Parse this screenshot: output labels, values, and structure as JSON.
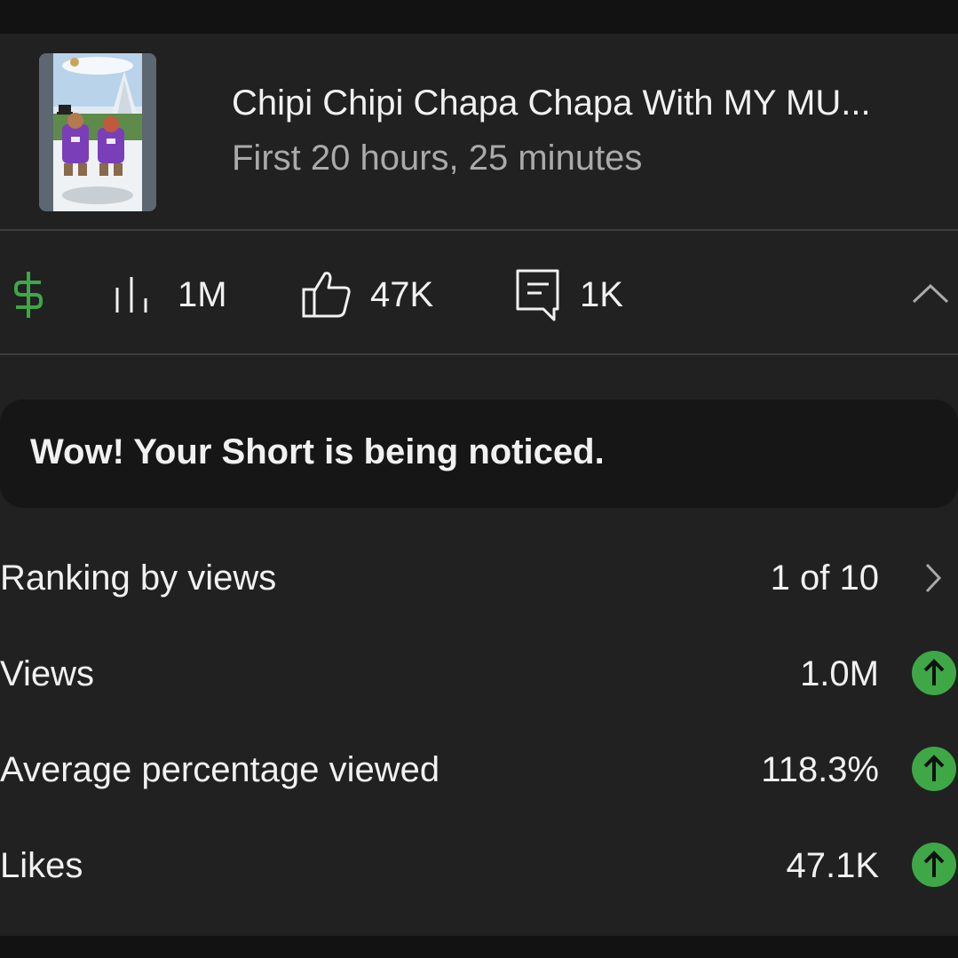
{
  "video": {
    "title": "Chipi Chipi Chapa Chapa With MY MU...",
    "subtitle": "First 20 hours, 25 minutes"
  },
  "stats": {
    "views": "1M",
    "likes": "47K",
    "comments": "1K"
  },
  "icons": {
    "monetization": "dollar-icon",
    "views": "bar-chart-icon",
    "likes": "thumbs-up-icon",
    "comments": "comment-icon",
    "collapse": "chevron-up-icon",
    "trend": "arrow-up-icon"
  },
  "notice": {
    "text": "Wow! Your Short is being noticed."
  },
  "metrics": [
    {
      "label": "Ranking by views",
      "value": "1 of 10",
      "indicator": "chevron"
    },
    {
      "label": "Views",
      "value": "1.0M",
      "indicator": "up"
    },
    {
      "label": "Average percentage viewed",
      "value": "118.3%",
      "indicator": "up"
    },
    {
      "label": "Likes",
      "value": "47.1K",
      "indicator": "up"
    }
  ],
  "colors": {
    "background": "#212121",
    "text": "#f1f1f1",
    "secondary_text": "#aaaaaa",
    "monetization_green": "#3ea746",
    "up_badge": "#3ea746",
    "notice_bg": "#161616",
    "divider": "#3d3d3d"
  }
}
